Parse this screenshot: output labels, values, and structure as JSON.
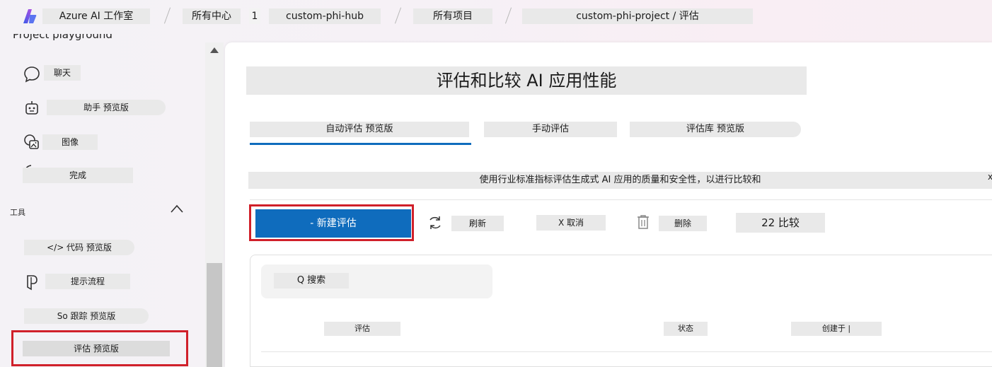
{
  "header": {
    "app_title": "Azure AI 工作室",
    "crumbs": [
      "所有中心",
      "custom-phi-hub",
      "所有项目",
      "custom-phi-project / 评估"
    ],
    "hub_badge": "1"
  },
  "sidebar": {
    "truncated_heading": "Project playground",
    "items": [
      {
        "label": "聊天",
        "icon": "chat-icon"
      },
      {
        "label": "助手 预览版",
        "icon": "assistant-bot-icon"
      },
      {
        "label": "图像",
        "icon": "image-icon"
      },
      {
        "label": "完成",
        "icon": "completion-icon"
      }
    ],
    "tools_label": "工具",
    "tools": [
      {
        "label": "</> 代码 预览版"
      },
      {
        "label": "提示流程",
        "icon": "prompt-flow-icon"
      },
      {
        "label": "So 跟踪 预览版"
      },
      {
        "label": "评估 预览版"
      }
    ]
  },
  "main": {
    "title": "评估和比较 AI 应用性能",
    "tabs": [
      "自动评估 预览版",
      "手动评估",
      "评估库 预览版"
    ],
    "description": "使用行业标准指标评估生成式 AI 应用的质量和安全性，以进行比较和",
    "description_close": "x",
    "toolbar": {
      "new_label": "- 新建评估",
      "refresh_label": "刷新",
      "cancel_label": "X 取消",
      "delete_label": "删除",
      "compare_label": "22 比较"
    },
    "search_label": "Q 搜索",
    "columns": [
      "评估",
      "状态",
      "创建于 |"
    ]
  },
  "colors": {
    "accent": "#0f6cbd",
    "highlight_border": "#d0202a"
  }
}
